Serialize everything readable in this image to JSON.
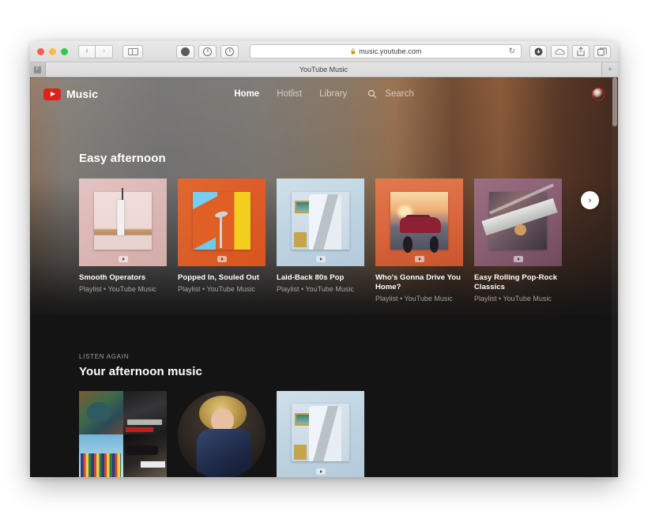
{
  "browser": {
    "traffic_lights": [
      "close",
      "minimize",
      "zoom"
    ],
    "back_label": "‹",
    "forward_label": "›",
    "sidebar_icon": "sidebar-icon",
    "mid_buttons": [
      "adblock-icon",
      "shield-icon",
      "info-icon"
    ],
    "url": "music.youtube.com",
    "lock_glyph": "🔒",
    "reload_glyph": "↻",
    "right_buttons": [
      "download-icon",
      "icloud-icon",
      "share-icon",
      "tabs-icon"
    ],
    "tab_title": "YouTube Music",
    "favicon_letter": "F",
    "new_tab_glyph": "+"
  },
  "app": {
    "brand": "Music",
    "nav": [
      {
        "label": "Home",
        "active": true
      },
      {
        "label": "Hotlist",
        "active": false
      },
      {
        "label": "Library",
        "active": false
      }
    ],
    "search_label": "Search",
    "search_icon": "search-icon",
    "avatar": "user-avatar"
  },
  "shelves": [
    {
      "id": "easy-afternoon",
      "eyebrow": "",
      "title": "Easy afternoon",
      "next_glyph": "›",
      "cards": [
        {
          "title": "Smooth Operators",
          "subtitle": "Playlist • YouTube Music",
          "art": "a1"
        },
        {
          "title": "Popped In, Souled Out",
          "subtitle": "Playlist • YouTube Music",
          "art": "a2"
        },
        {
          "title": "Laid-Back 80s Pop",
          "subtitle": "Playlist • YouTube Music",
          "art": "a3"
        },
        {
          "title": "Who's Gonna Drive You Home?",
          "subtitle": "Playlist • YouTube Music",
          "art": "a4"
        },
        {
          "title": "Easy Rolling Pop-Rock Classics",
          "subtitle": "Playlist • YouTube Music",
          "art": "a5"
        }
      ]
    },
    {
      "id": "listen-again",
      "eyebrow": "LISTEN AGAIN",
      "title": "Your afternoon music",
      "cards": [
        {
          "title": "",
          "subtitle": "",
          "art": "quad-collage"
        },
        {
          "title": "",
          "subtitle": "",
          "art": "artist-circle"
        },
        {
          "title": "",
          "subtitle": "",
          "art": "a3"
        }
      ]
    }
  ],
  "colors": {
    "brand_red": "#e0211b",
    "page_bg": "#141414",
    "text_primary": "#ffffff",
    "text_secondary": "rgba(255,255,255,0.56)"
  }
}
